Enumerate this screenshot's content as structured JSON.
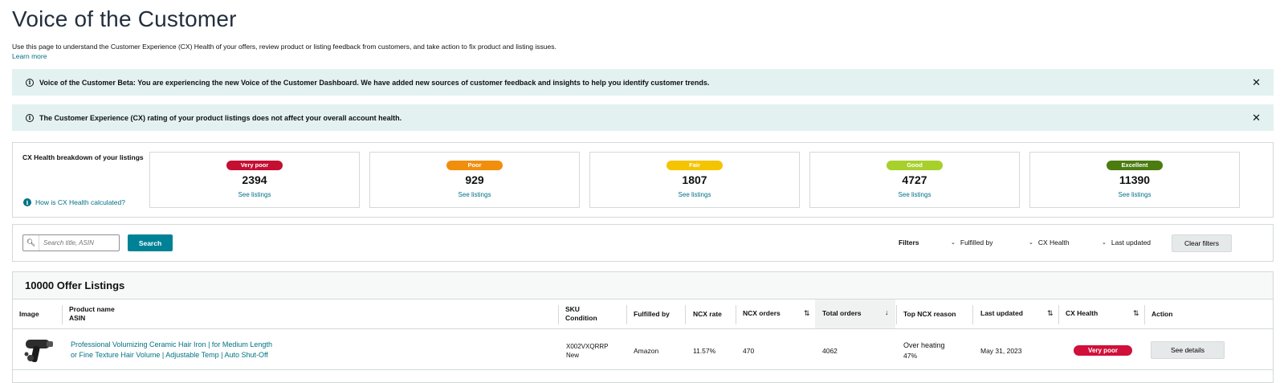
{
  "page": {
    "title": "Voice of the Customer",
    "description": "Use this page to understand the Customer Experience (CX) Health of your offers, review product or listing feedback from customers, and take action to fix product and listing issues.",
    "learn_more": "Learn more"
  },
  "banners": [
    {
      "text": "Voice of the Customer Beta: You are experiencing the new Voice of the Customer Dashboard. We have added new sources of customer feedback and insights to help you identify customer trends.",
      "icon": "info-icon",
      "close": "✕"
    },
    {
      "text": "The Customer Experience (CX) rating of your product listings does not affect your overall account health.",
      "icon": "info-icon",
      "close": "✕"
    }
  ],
  "cx_health": {
    "label": "CX Health breakdown of your listings",
    "how_link": "How is CX Health calculated?",
    "cards": [
      {
        "badge": "Very poor",
        "count": "2394",
        "link": "See listings",
        "color": "#c40f32"
      },
      {
        "badge": "Poor",
        "count": "929",
        "link": "See listings",
        "color": "#f18e0c"
      },
      {
        "badge": "Fair",
        "count": "1807",
        "link": "See listings",
        "color": "#f5c400"
      },
      {
        "badge": "Good",
        "count": "4727",
        "link": "See listings",
        "color": "#a7d02b"
      },
      {
        "badge": "Excellent",
        "count": "11390",
        "link": "See listings",
        "color": "#4b7c0f"
      }
    ]
  },
  "filters": {
    "search_placeholder": "Search title, ASIN",
    "search_button": "Search",
    "label": "Filters",
    "dropdowns": [
      "Fulfilled by",
      "CX Health",
      "Last updated"
    ],
    "clear": "Clear filters"
  },
  "table": {
    "title": "10000 Offer Listings",
    "columns": {
      "image": "Image",
      "product_name": "Product name",
      "asin": "ASIN",
      "sku": "SKU",
      "condition": "Condition",
      "fulfilled_by": "Fulfilled by",
      "ncx_rate": "NCX rate",
      "ncx_orders": "NCX orders",
      "total_orders": "Total orders",
      "top_reason": "Top NCX reason",
      "last_updated": "Last updated",
      "cx_health": "CX Health",
      "action": "Action"
    },
    "rows": [
      {
        "product_name_line1": "Professional Volumizing Ceramic Hair Iron | for Medium Length",
        "product_name_line2": "or Fine Texture Hair Volume | Adjustable Temp | Auto Shut-Off",
        "sku": "X002VXQRRP",
        "condition": "New",
        "fulfilled_by": "Amazon",
        "ncx_rate": "11.57%",
        "ncx_orders": "470",
        "total_orders": "4062",
        "top_reason": "Over heating",
        "top_reason_pct": "47%",
        "last_updated": "May 31, 2023",
        "cx_health": "Very poor",
        "action": "See details"
      }
    ]
  }
}
